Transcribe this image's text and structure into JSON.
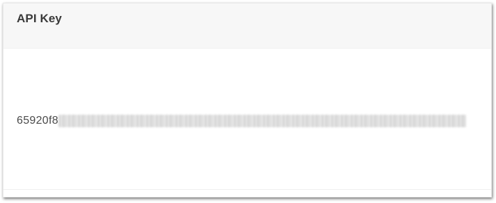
{
  "card": {
    "title": "API Key",
    "api_key_visible_prefix": "65920f8",
    "api_key_redacted": true
  }
}
